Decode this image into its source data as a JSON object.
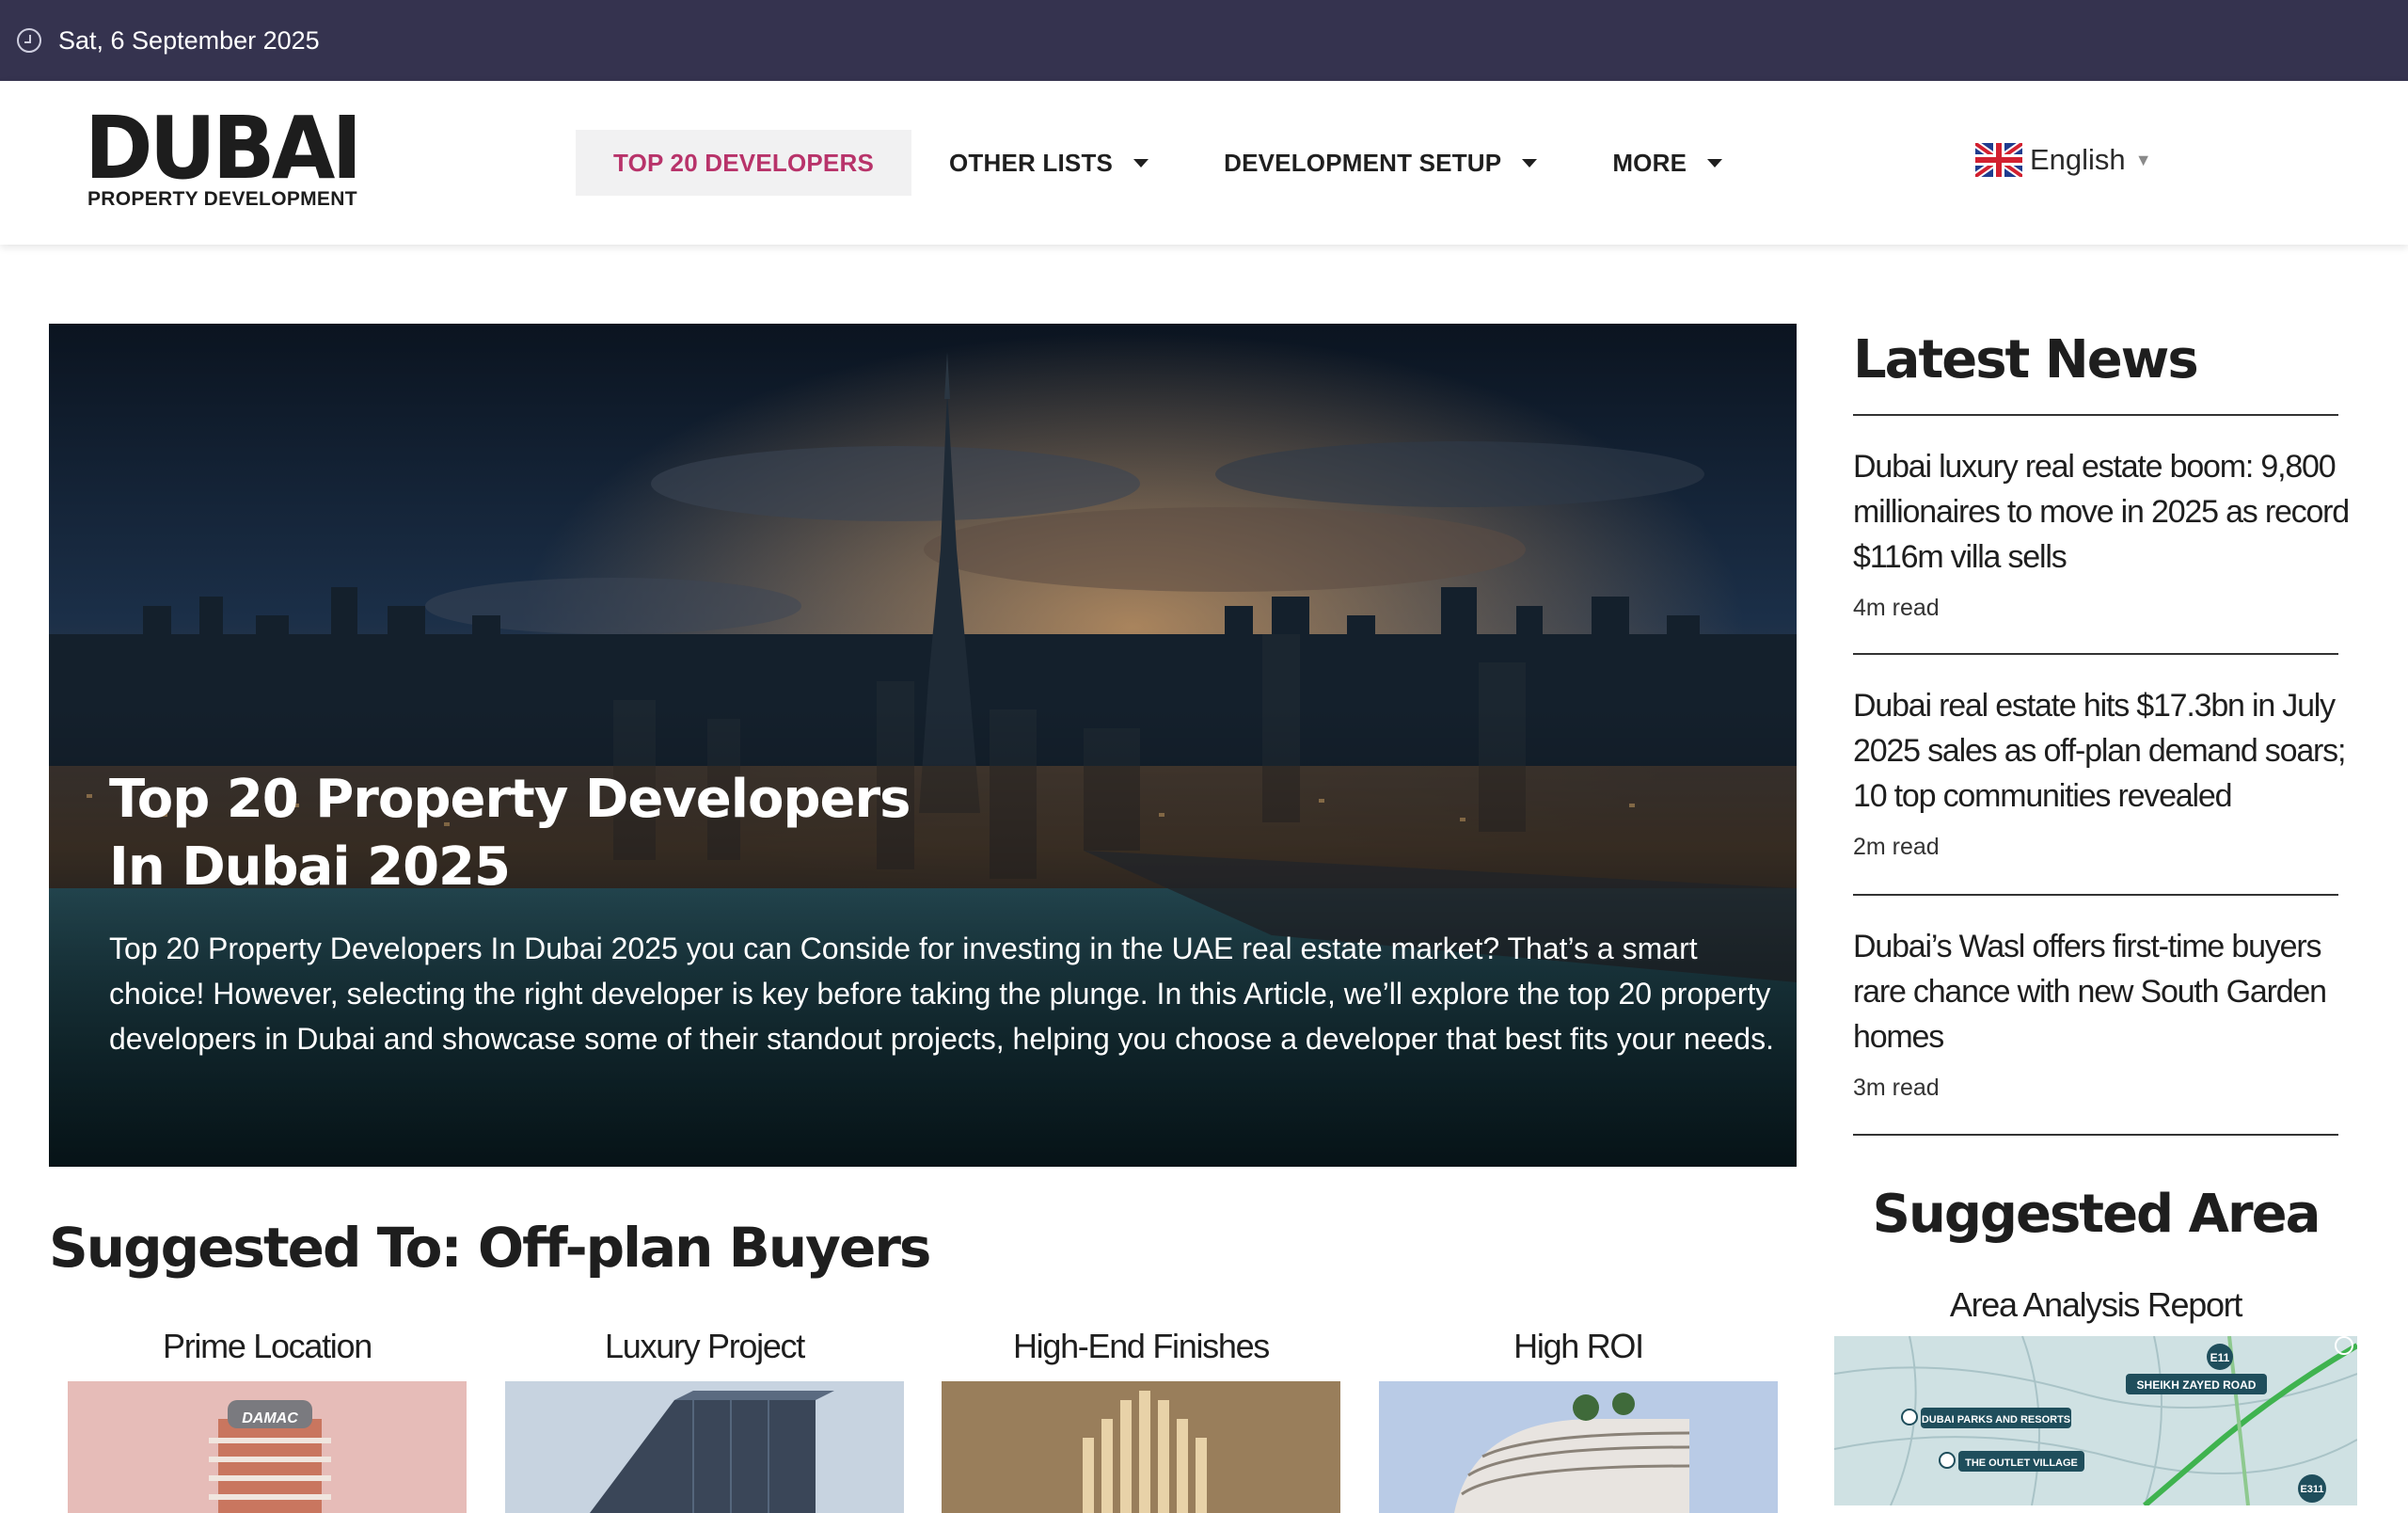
{
  "topbar": {
    "date": "Sat, 6 September 2025",
    "icon": "clock-icon"
  },
  "logo": {
    "main": "DUBAI",
    "sub": "PROPERTY DEVELOPMENT"
  },
  "nav": {
    "items": [
      {
        "label": "TOP 20 DEVELOPERS",
        "active": true,
        "dropdown": false
      },
      {
        "label": "OTHER LISTS",
        "active": false,
        "dropdown": true
      },
      {
        "label": "DEVELOPMENT SETUP",
        "active": false,
        "dropdown": true
      },
      {
        "label": "MORE",
        "active": false,
        "dropdown": true
      }
    ],
    "active_color": "#b8336a"
  },
  "language": {
    "label": "English",
    "flag": "uk-flag-icon"
  },
  "hero": {
    "title_line1": "Top 20 Property Developers",
    "title_line2": "In Dubai 2025",
    "description": "Top 20 Property Developers In Dubai 2025 you can Conside for investing in the UAE real estate market? That’s a smart choice! However,  selecting the right  developer is key before taking the plunge. In this Article, we’ll  explore the top 20 property developers in Dubai and showcase some of their standout  projects, helping you choose a developer that best fits your needs."
  },
  "latest_news": {
    "title": "Latest News",
    "items": [
      {
        "headline": "Dubai luxury real estate boom: 9,800 millionaires to move in 2025 as record $116m villa sells",
        "read": "4m read"
      },
      {
        "headline": "Dubai real estate hits $17.3bn in July 2025 sales as off-plan demand soars; 10 top communities revealed",
        "read": "2m read"
      },
      {
        "headline": "Dubai’s Wasl offers first-time buyers rare chance with new South Garden homes",
        "read": "3m read"
      }
    ]
  },
  "suggested_area": {
    "title": "Suggested Area",
    "label": "Area Analysis Report",
    "map_labels": [
      "SHEIKH ZAYED ROAD",
      "DUBAI PARKS AND RESORTS",
      "THE OUTLET VILLAGE",
      "E11",
      "E311"
    ]
  },
  "suggested": {
    "title": "Suggested To: Off-plan Buyers",
    "cards": [
      {
        "label": "Prime Location",
        "logo_text": "DAMAC"
      },
      {
        "label": "Luxury Project"
      },
      {
        "label": "High-End Finishes"
      },
      {
        "label": "High ROI"
      }
    ]
  },
  "colors": {
    "topbar_bg": "#35334f",
    "accent": "#b8336a"
  }
}
